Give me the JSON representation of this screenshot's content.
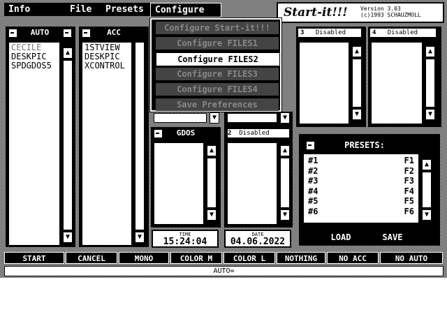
{
  "menubar": {
    "items": [
      {
        "label": "Info"
      },
      {
        "label": "File"
      },
      {
        "label": "Presets"
      },
      {
        "label": "Configure"
      }
    ]
  },
  "logo": {
    "title": "Start-it!!!",
    "version": "Version 3.03",
    "copyright": "(c)1993 SCHAUZMOLL"
  },
  "dropdown": {
    "items": [
      {
        "label": "Configure Start-it!!!"
      },
      {
        "label": "Configure FILES1"
      },
      {
        "label": "Configure FILES2"
      },
      {
        "label": "Configure FILES3"
      },
      {
        "label": "Configure FILES4"
      },
      {
        "label": "Save Preferences"
      }
    ]
  },
  "auto_panel": {
    "title": "AUTO",
    "items": [
      "CECILE",
      "DESKPIC",
      "SPDGDOS5"
    ]
  },
  "acc_panel": {
    "title": "ACC",
    "items": [
      "1STVIEW",
      "DESKPIC",
      "XCONTROL"
    ]
  },
  "gdos_panel": {
    "title": "GDOS"
  },
  "files": {
    "f2": {
      "num": "2",
      "status": "Disabled"
    },
    "f3": {
      "num": "3",
      "status": "Disabled"
    },
    "f4": {
      "num": "4",
      "status": "Disabled"
    }
  },
  "presets": {
    "title": "PRESETS:",
    "rows": [
      {
        "name": "#1",
        "key": "F1"
      },
      {
        "name": "#2",
        "key": "F2"
      },
      {
        "name": "#3",
        "key": "F3"
      },
      {
        "name": "#4",
        "key": "F4"
      },
      {
        "name": "#5",
        "key": "F5"
      },
      {
        "name": "#6",
        "key": "F6"
      }
    ],
    "load_label": "LOAD",
    "save_label": "SAVE"
  },
  "clock": {
    "time_label": "TIME",
    "time": "15:24:04",
    "date_label": "DATE",
    "date": "04.06.2022"
  },
  "bottom_buttons": [
    "START",
    "CANCEL",
    "MONO",
    "COLOR M",
    "COLOR L",
    "NOTHING",
    "NO ACC",
    "NO AUTO"
  ],
  "status": {
    "text": "AUTO="
  },
  "icons": {
    "up": "up-arrow-icon",
    "down": "down-arrow-icon",
    "close": "close-box-icon"
  }
}
